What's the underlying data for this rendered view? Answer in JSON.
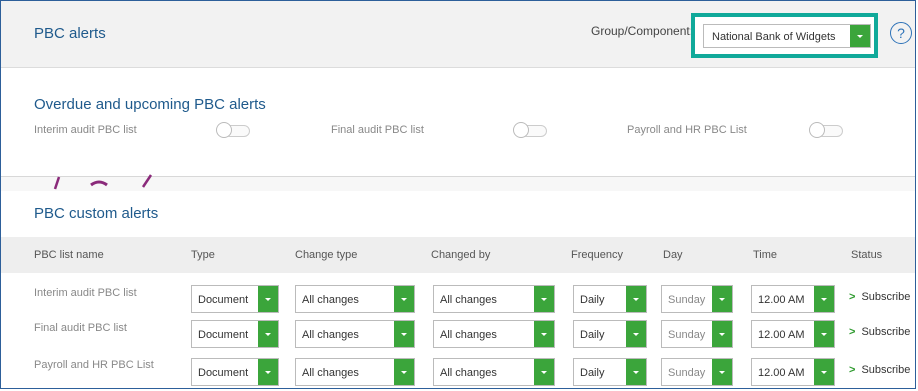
{
  "header": {
    "title": "PBC alerts",
    "group_label": "Group/Component:",
    "group_value": "National Bank of Widgets",
    "help": "?"
  },
  "overdue": {
    "title": "Overdue and upcoming PBC alerts",
    "toggles": [
      {
        "label": "Interim audit PBC list",
        "on": false
      },
      {
        "label": "Final audit PBC list",
        "on": false
      },
      {
        "label": "Payroll and HR PBC List",
        "on": false
      }
    ]
  },
  "custom": {
    "title": "PBC custom alerts",
    "columns": [
      "PBC list name",
      "Type",
      "Change type",
      "Changed by",
      "Frequency",
      "Day",
      "Time",
      "Status"
    ],
    "rows": [
      {
        "name": "Interim audit PBC list",
        "type": "Document",
        "change_type": "All changes",
        "changed_by": "All changes",
        "frequency": "Daily",
        "day": "Sunday",
        "time": "12.00 AM",
        "status": "Subscribe"
      },
      {
        "name": "Final audit PBC list",
        "type": "Document",
        "change_type": "All changes",
        "changed_by": "All changes",
        "frequency": "Daily",
        "day": "Sunday",
        "time": "12.00 AM",
        "status": "Subscribe"
      },
      {
        "name": "Payroll and HR PBC List",
        "type": "Document",
        "change_type": "All changes",
        "changed_by": "All changes",
        "frequency": "Daily",
        "day": "Sunday",
        "time": "12.00 AM",
        "status": "Subscribe"
      }
    ]
  },
  "colors": {
    "accent": "#3ba53b",
    "title": "#1f5a8c",
    "highlight": "#10a99a",
    "frame": "#2d5f9a"
  },
  "icons": {
    "dropdown": "chevron-down-icon",
    "help": "question-circle-icon",
    "subscribe": "chevron-right-icon"
  }
}
